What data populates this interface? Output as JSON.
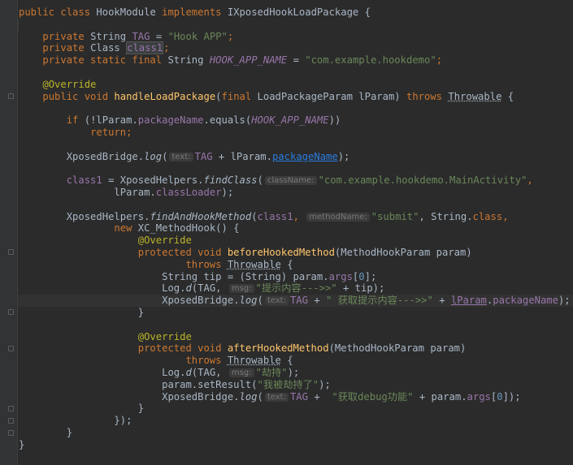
{
  "code": {
    "class_decl": {
      "kw1": "public",
      "kw2": "class",
      "name": "HookModule",
      "kw3": "implements",
      "iface": "IXposedHookLoadPackage",
      "brace": "{"
    },
    "l3": {
      "kw": "private",
      "type": "String",
      "field": "TAG",
      "eq": "=",
      "value": "\"Hook APP\"",
      "semi": ";"
    },
    "l4": {
      "kw": "private",
      "type": "Class",
      "field": "class1",
      "semi": ";"
    },
    "l5": {
      "kw": "private static final",
      "type": "String",
      "const": "HOOK_APP_NAME",
      "eq": "=",
      "value": "\"com.example.hookdemo\"",
      "semi": ";"
    },
    "l7": {
      "ann": "@Override"
    },
    "l8": {
      "kw": "public void",
      "method": "handleLoadPackage",
      "p1": "(",
      "kw2": "final",
      "ptype": "LoadPackageParam lParam)",
      "throws": "throws",
      "exc": "Throwable",
      "brace": "{"
    },
    "l10": {
      "kw": "if",
      "open": "(!lParam.",
      "field": "packageName",
      "mid": ".equals(",
      "const": "HOOK_APP_NAME",
      "close": "))"
    },
    "l11": {
      "kw": "return",
      "semi": ";"
    },
    "l13": {
      "pre": "XposedBridge.",
      "fn": "log",
      "open": "(",
      "hint": "text:",
      "field": "TAG",
      "mid": "+ lParam.",
      "link": "packageName",
      "close": ");"
    },
    "l15": {
      "field": "class1",
      "mid": "= XposedHelpers.",
      "fn": "findClass",
      "open": "(",
      "hint": "className:",
      "value": "\"com.example.hookdemo.MainActivity\"",
      "comma": ","
    },
    "l16": {
      "pre": "lParam.",
      "field": "classLoader",
      "close": ");"
    },
    "l18": {
      "pre": "XposedHelpers.",
      "fn": "findAndHookMethod",
      "open": "(",
      "field": "class1",
      "comma": ",",
      "hint": "methodName:",
      "value": "\"submit\"",
      "mid": ", String.",
      "kw": "class",
      "comma2": ","
    },
    "l19": {
      "kw": "new",
      "rest": "XC_MethodHook() {"
    },
    "l20": {
      "ann": "@Override"
    },
    "l21": {
      "kw": "protected void",
      "method": "beforeHookedMethod",
      "rest": "(MethodHookParam param)"
    },
    "l22": {
      "kw": "throws",
      "exc": "Throwable",
      "brace": "{"
    },
    "l23": {
      "pre": "String tip = (String) param.",
      "field": "args",
      "open": "[",
      "num": "0",
      "close": "];"
    },
    "l24": {
      "pre": "Log.",
      "fn": "d",
      "open": "(TAG,",
      "hint": "msg:",
      "value": "\"提示内容--->>\"",
      "rest": "+ tip);"
    },
    "l25": {
      "pre": "XposedBridge.",
      "fn": "log",
      "open": "(",
      "hint": "text:",
      "field": "TAG",
      "mid": "+",
      "value": "\" 获取提示内容--->>\"",
      "mid2": "+",
      "ref": "lParam",
      "dot": ".",
      "field2": "packageName",
      "close": ");"
    },
    "l26": {
      "brace": "}"
    },
    "l28": {
      "ann": "@Override"
    },
    "l29": {
      "kw": "protected void",
      "method": "afterHookedMethod",
      "rest": "(MethodHookParam param)"
    },
    "l30": {
      "kw": "throws",
      "exc": "Throwable",
      "brace": "{"
    },
    "l31": {
      "pre": "Log.",
      "fn": "d",
      "open": "(TAG,",
      "hint": "msg:",
      "value": "\"劫持\"",
      "close": ");"
    },
    "l32": {
      "pre": "param.setResult(",
      "value": "\"我被劫持了\"",
      "close": ");"
    },
    "l33": {
      "pre": "XposedBridge.",
      "fn": "log",
      "open": "(",
      "hint": "text:",
      "field": "TAG",
      "mid": "+",
      "value": "\"获取debug功能\"",
      "mid2": "+ param.",
      "field2": "args",
      "open2": "[",
      "num": "0",
      "close": "]);"
    },
    "l34": {
      "brace": "}"
    },
    "l35": {
      "close": "});"
    },
    "l36": {
      "brace": "}"
    },
    "l37": {
      "brace": "}"
    }
  }
}
